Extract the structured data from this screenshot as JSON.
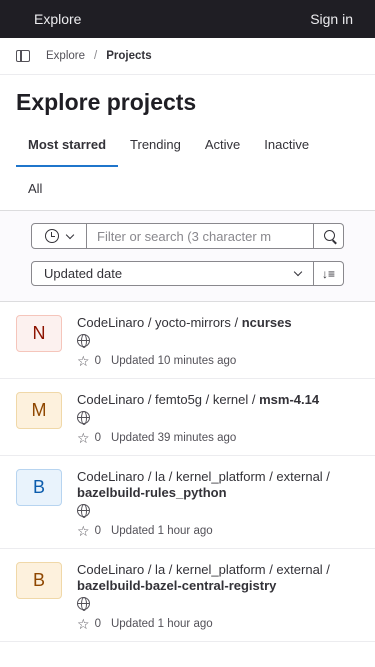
{
  "topbar": {
    "title": "Explore",
    "signin": "Sign in"
  },
  "breadcrumb": {
    "root": "Explore",
    "separator": "/",
    "current": "Projects"
  },
  "page_title": "Explore projects",
  "tabs": [
    "Most starred",
    "Trending",
    "Active",
    "Inactive",
    "All"
  ],
  "filter": {
    "placeholder": "Filter or search (3 character m",
    "sort_label": "Updated date"
  },
  "projects": [
    {
      "initial": "N",
      "avatar_bg": "#fcf1ef",
      "avatar_border": "#f5c5bb",
      "avatar_color": "#8d1300",
      "path": "CodeLinaro / yocto-mirrors / ",
      "name": "ncurses",
      "stars": "0",
      "updated": "Updated 10 minutes ago"
    },
    {
      "initial": "M",
      "avatar_bg": "#fdf1dd",
      "avatar_border": "#f0d8a8",
      "avatar_color": "#8f4700",
      "path": "CodeLinaro / femto5g / kernel / ",
      "name": "msm-4.14",
      "stars": "0",
      "updated": "Updated 39 minutes ago"
    },
    {
      "initial": "B",
      "avatar_bg": "#e9f3fc",
      "avatar_border": "#b7d4f0",
      "avatar_color": "#0b5cad",
      "path": "CodeLinaro / la / kernel_platform / external / ",
      "name": "bazelbuild-rules_python",
      "stars": "0",
      "updated": "Updated 1 hour ago"
    },
    {
      "initial": "B",
      "avatar_bg": "#fdf1dd",
      "avatar_border": "#f0d8a8",
      "avatar_color": "#8f4700",
      "path": "CodeLinaro / la / kernel_platform / external / ",
      "name": "bazelbuild-bazel-central-registry",
      "stars": "0",
      "updated": "Updated 1 hour ago"
    }
  ]
}
